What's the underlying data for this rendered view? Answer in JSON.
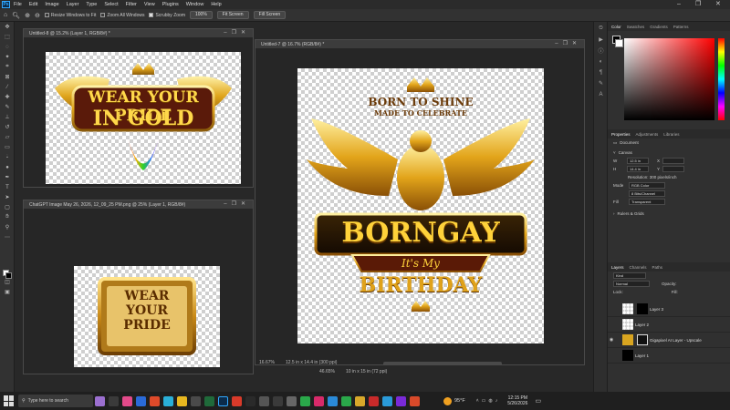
{
  "menubar": {
    "app": "Ps",
    "items": [
      "File",
      "Edit",
      "Image",
      "Layer",
      "Type",
      "Select",
      "Filter",
      "View",
      "Plugins",
      "Window",
      "Help"
    ]
  },
  "options": {
    "resize_windows": "Resize Windows to Fit",
    "zoom_all": "Zoom All Windows",
    "scrubby": "Scrubby Zoom",
    "pct_btn": "100%",
    "fit_btn": "Fit Screen",
    "fill_btn": "Fill Screen"
  },
  "docs": {
    "doc1": {
      "title": "Untitled-8 @ 15.2% (Layer 1, RGB/8#) *"
    },
    "doc2": {
      "title": "ChatGPT Image May 26, 2026, 12_09_25 PM.png @ 25% (Layer 1, RGB/8#)"
    },
    "doc3": {
      "title": "Untitled-7 @ 16.7% (RGB/8#) *",
      "zoom": "16.67%",
      "size": "12.5 in x 14.4 in (300 ppi)"
    },
    "bottom": {
      "zoom": "46.65%",
      "size": "10 in x 15 in (72 ppi)"
    }
  },
  "artwork": {
    "a1_line1": "WEAR YOUR PRIDE",
    "a1_line2": "IN GOLD",
    "a2_line1": "WEAR",
    "a2_line2": "YOUR",
    "a2_line3": "PRIDE",
    "a3_top1": "BORN TO SHINE",
    "a3_top2": "MADE TO CELEBRATE",
    "a3_main": "BORNGAY",
    "a3_sub": "It's My",
    "a3_bottom": "BIRTHDAY"
  },
  "color_panel": {
    "tabs": [
      "Color",
      "Swatches",
      "Gradients",
      "Patterns"
    ]
  },
  "properties": {
    "tabs": [
      "Properties",
      "Adjustments",
      "Libraries"
    ],
    "document_label": "Document",
    "canvas_label": "Canvas",
    "w_label": "W",
    "w_value": "12.5 in",
    "h_label": "H",
    "h_value": "14.4 in",
    "x_label": "X",
    "y_label": "Y",
    "resolution": "Resolution: 300 pixels/inch",
    "mode_label": "Mode",
    "mode_value": "RGB Color",
    "depth_value": "8 Bits/Channel",
    "fill_label": "Fill",
    "fill_value": "Transparent",
    "rulers_label": "Rulers & Grids"
  },
  "layers_panel": {
    "tabs": [
      "Layers",
      "Channels",
      "Paths"
    ],
    "kind": "Kind",
    "blend": "Normal",
    "opacity": "Opacity:",
    "lock": "Lock:",
    "fill": "Fill:",
    "layers": [
      {
        "name": "Layer 3"
      },
      {
        "name": "Layer 2"
      },
      {
        "name": "Gigapixel AI Layer - Upscale"
      },
      {
        "name": "Layer 1"
      }
    ]
  },
  "taskbar": {
    "search_placeholder": "Type here to search",
    "weather": "95°F",
    "time": "12:15 PM",
    "date": "5/26/2026"
  },
  "colors": {
    "gold": "#d9a520",
    "accent": "#31a8ff"
  }
}
